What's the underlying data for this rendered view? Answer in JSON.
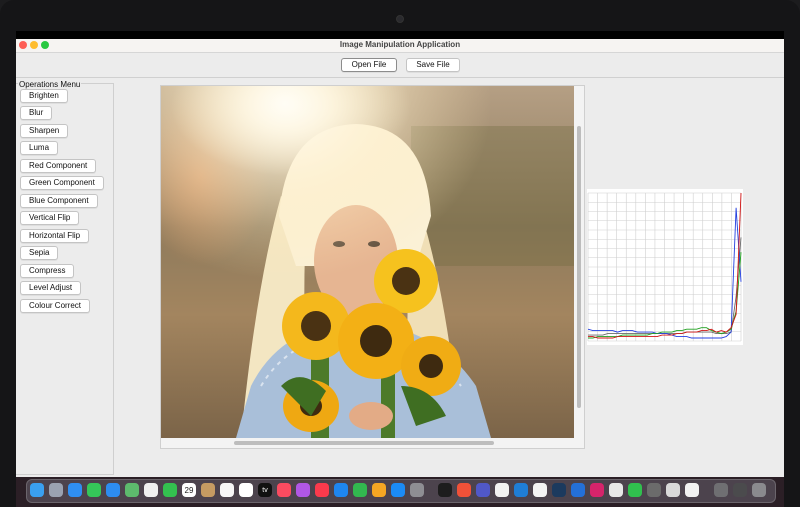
{
  "window": {
    "title": "Image Manipulation Application"
  },
  "toolbar": {
    "open_label": "Open File",
    "save_label": "Save File"
  },
  "operations": {
    "title": "Operations Menu",
    "items": [
      "Brighten",
      "Blur",
      "Sharpen",
      "Luma",
      "Red Component",
      "Green Component",
      "Blue Component",
      "Vertical Flip",
      "Horizontal Flip",
      "Sepia",
      "Compress",
      "Level Adjust",
      "Colour Correct"
    ]
  },
  "image": {
    "icon": "sunflower-portrait-photo"
  },
  "histogram": {
    "colors": {
      "red": "#d11515",
      "green": "#1fa01f",
      "blue": "#2440e0",
      "intensity": "#6b6b6b"
    },
    "bins": 32,
    "red": [
      3,
      3,
      2,
      2,
      2,
      2,
      3,
      3,
      3,
      3,
      3,
      3,
      3,
      3,
      3,
      4,
      4,
      4,
      5,
      5,
      6,
      6,
      6,
      7,
      7,
      8,
      6,
      7,
      6,
      9,
      18,
      100
    ],
    "green": [
      2,
      2,
      3,
      3,
      3,
      3,
      3,
      4,
      4,
      4,
      4,
      4,
      4,
      5,
      5,
      6,
      6,
      6,
      7,
      7,
      8,
      8,
      8,
      9,
      9,
      7,
      6,
      5,
      6,
      8,
      20,
      60
    ],
    "blue": [
      8,
      7,
      7,
      7,
      7,
      7,
      6,
      7,
      7,
      7,
      6,
      6,
      6,
      6,
      5,
      5,
      5,
      4,
      3,
      3,
      3,
      2,
      2,
      2,
      2,
      2,
      2,
      2,
      3,
      6,
      90,
      40
    ],
    "intensity": [
      4,
      4,
      4,
      4,
      5,
      5,
      5,
      5,
      5,
      5,
      5,
      5,
      5,
      5,
      5,
      5,
      5,
      5,
      5,
      5,
      6,
      6,
      6,
      6,
      6,
      6,
      5,
      5,
      5,
      6,
      30,
      70
    ]
  },
  "dock": {
    "apps": [
      "finder",
      "launchpad",
      "safari",
      "messages",
      "mail",
      "maps",
      "photos",
      "facetime",
      "calendar",
      "notes",
      "reminders",
      "tv",
      "music",
      "podcasts",
      "news",
      "keynote",
      "numbers",
      "pages",
      "app-store",
      "system-preferences",
      "terminal",
      "swift",
      "teams",
      "chrome",
      "vscode",
      "mongodb",
      "pycharm",
      "webstorm",
      "intellij",
      "jar-launcher",
      "whatsapp",
      "utility",
      "preview",
      "java",
      "documents",
      "archive",
      "trash"
    ],
    "calendar_day": "29",
    "tv_label": "tv"
  },
  "accent": "#2e7cf6"
}
